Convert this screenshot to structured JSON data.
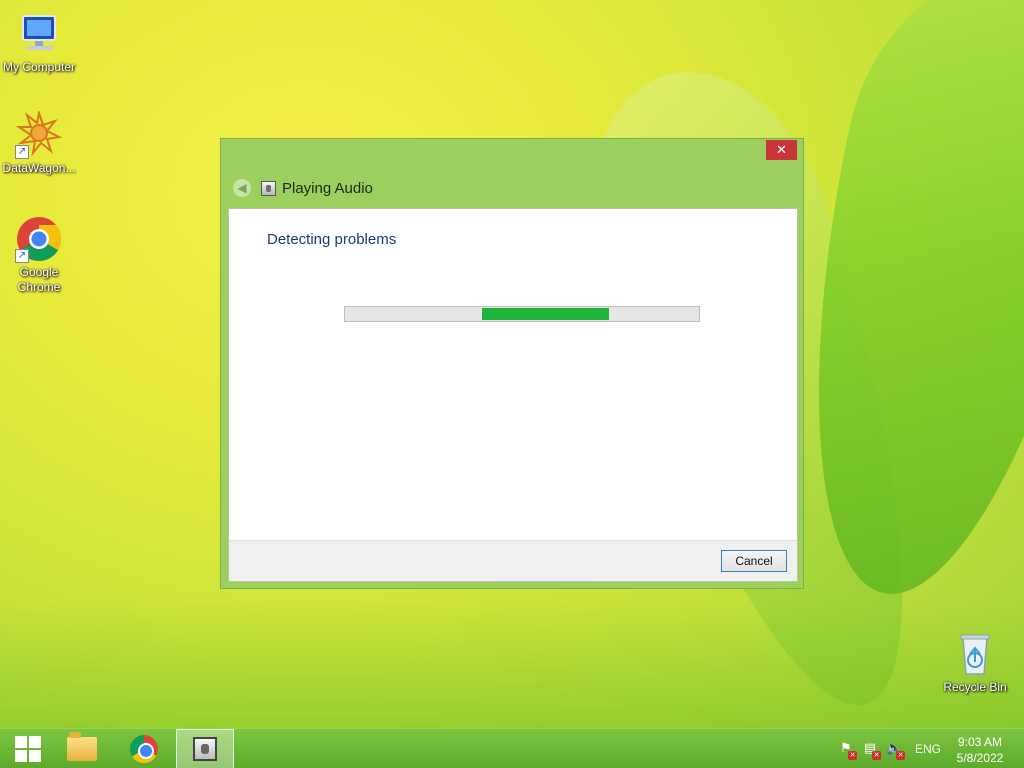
{
  "desktop": {
    "icons": [
      {
        "label": "My Computer",
        "icon": "computer-icon"
      },
      {
        "label": "DataWagon...",
        "icon": "datawagon-icon"
      },
      {
        "label": "Google Chrome",
        "icon": "chrome-icon"
      },
      {
        "label": "Recycle Bin",
        "icon": "recycle-bin-icon"
      }
    ]
  },
  "dialog": {
    "title": "Playing Audio",
    "close_label": "✕",
    "heading": "Detecting problems",
    "progress_percent": 36,
    "cancel_label": "Cancel"
  },
  "taskbar": {
    "apps": [
      {
        "name": "start",
        "icon": "windows-logo-icon"
      },
      {
        "name": "file-explorer",
        "icon": "folder-icon"
      },
      {
        "name": "chrome",
        "icon": "chrome-icon"
      },
      {
        "name": "playing-audio",
        "icon": "audio-troubleshooter-icon",
        "active": true
      }
    ],
    "tray": {
      "language": "ENG",
      "time": "9:03 AM",
      "date": "5/8/2022",
      "icons": [
        "action-center-flag-icon",
        "network-icon",
        "volume-muted-icon"
      ]
    }
  },
  "colors": {
    "close_button": "#c7373a",
    "dialog_frame": "#9ccf5d",
    "progress_fill": "#1fb33b",
    "heading": "#1e3a78",
    "taskbar": "#6db636"
  }
}
